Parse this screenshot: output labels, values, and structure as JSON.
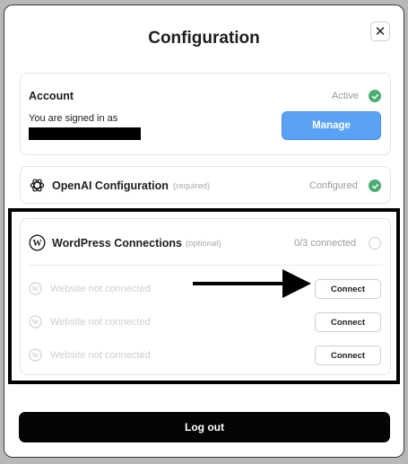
{
  "modal": {
    "title": "Configuration",
    "close_symbol": "✕"
  },
  "account": {
    "label": "Account",
    "status": "Active",
    "signed_in_text": "You are signed in as",
    "manage_label": "Manage"
  },
  "openai": {
    "label": "OpenAI Configuration",
    "tag": "(required)",
    "status": "Configured"
  },
  "wordpress": {
    "label": "WordPress Connections",
    "tag": "(optional)",
    "status": "0/3 connected",
    "sites": [
      {
        "label": "Website not connected",
        "button": "Connect"
      },
      {
        "label": "Website not connected",
        "button": "Connect"
      },
      {
        "label": "Website not connected",
        "button": "Connect"
      }
    ]
  },
  "logout_label": "Log out",
  "colors": {
    "accent_blue": "#5aa2f6",
    "success_green": "#4cae72",
    "logout_black": "#050505"
  },
  "icons": {
    "close": "close-icon",
    "active_check": "check-circle-icon",
    "openai": "openai-logo-icon",
    "wordpress": "wordpress-logo-icon",
    "annotation_arrow": "arrow-right-icon"
  }
}
